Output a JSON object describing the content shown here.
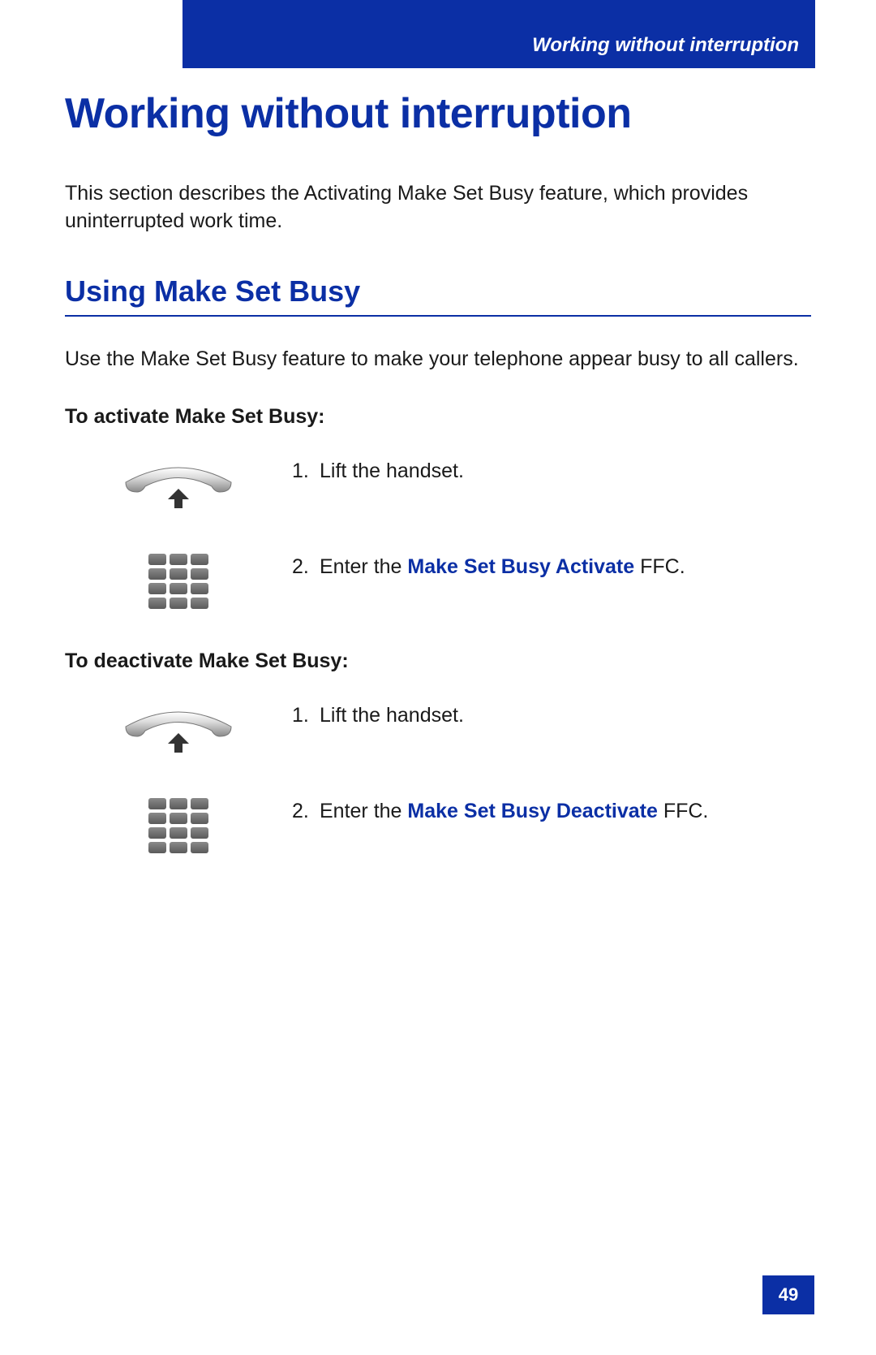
{
  "header": {
    "running_title": "Working without interruption"
  },
  "page": {
    "title": "Working without interruption",
    "intro": "This section describes the Activating Make Set Busy feature, which provides uninterrupted work time.",
    "h2": "Using Make Set Busy",
    "para": "Use the Make Set Busy feature to make your telephone appear busy to all callers.",
    "number": "49"
  },
  "activate": {
    "heading": "To activate Make Set Busy:",
    "steps": [
      {
        "num": "1.",
        "pre": "",
        "em": "",
        "post": "Lift the handset."
      },
      {
        "num": "2.",
        "pre": "Enter the ",
        "em": "Make Set Busy Activate",
        "post": " FFC."
      }
    ]
  },
  "deactivate": {
    "heading": "To deactivate Make Set Busy:",
    "steps": [
      {
        "num": "1.",
        "pre": "",
        "em": "",
        "post": "Lift the handset."
      },
      {
        "num": "2.",
        "pre": "Enter the ",
        "em": "Make Set Busy Deactivate",
        "post": " FFC."
      }
    ]
  }
}
